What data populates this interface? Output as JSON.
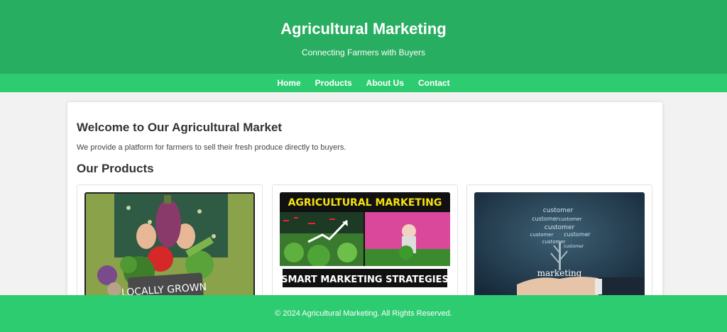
{
  "header": {
    "title": "Agricultural Marketing",
    "subtitle": "Connecting Farmers with Buyers"
  },
  "nav": {
    "items": [
      "Home",
      "Products",
      "About Us",
      "Contact"
    ]
  },
  "main": {
    "welcome_title": "Welcome to Our Agricultural Market",
    "intro": "We provide a platform for farmers to sell their fresh produce directly to buyers.",
    "products_title": "Our Products",
    "cards": [
      {
        "sign": "LOCALLY GROWN"
      },
      {
        "banner_top": "AGRICULTURAL MARKETING",
        "banner_bottom": "SMART MARKETING STRATEGIES"
      },
      {
        "word": "customer",
        "caption": "marketing"
      }
    ]
  },
  "footer": {
    "text": "© 2024 Agricultural Marketing. All Rights Reserved."
  },
  "colors": {
    "header_bg": "#27ae60",
    "nav_bg": "#2ecc71",
    "footer_bg": "#2ecc71",
    "page_bg": "#f2f2f2"
  }
}
